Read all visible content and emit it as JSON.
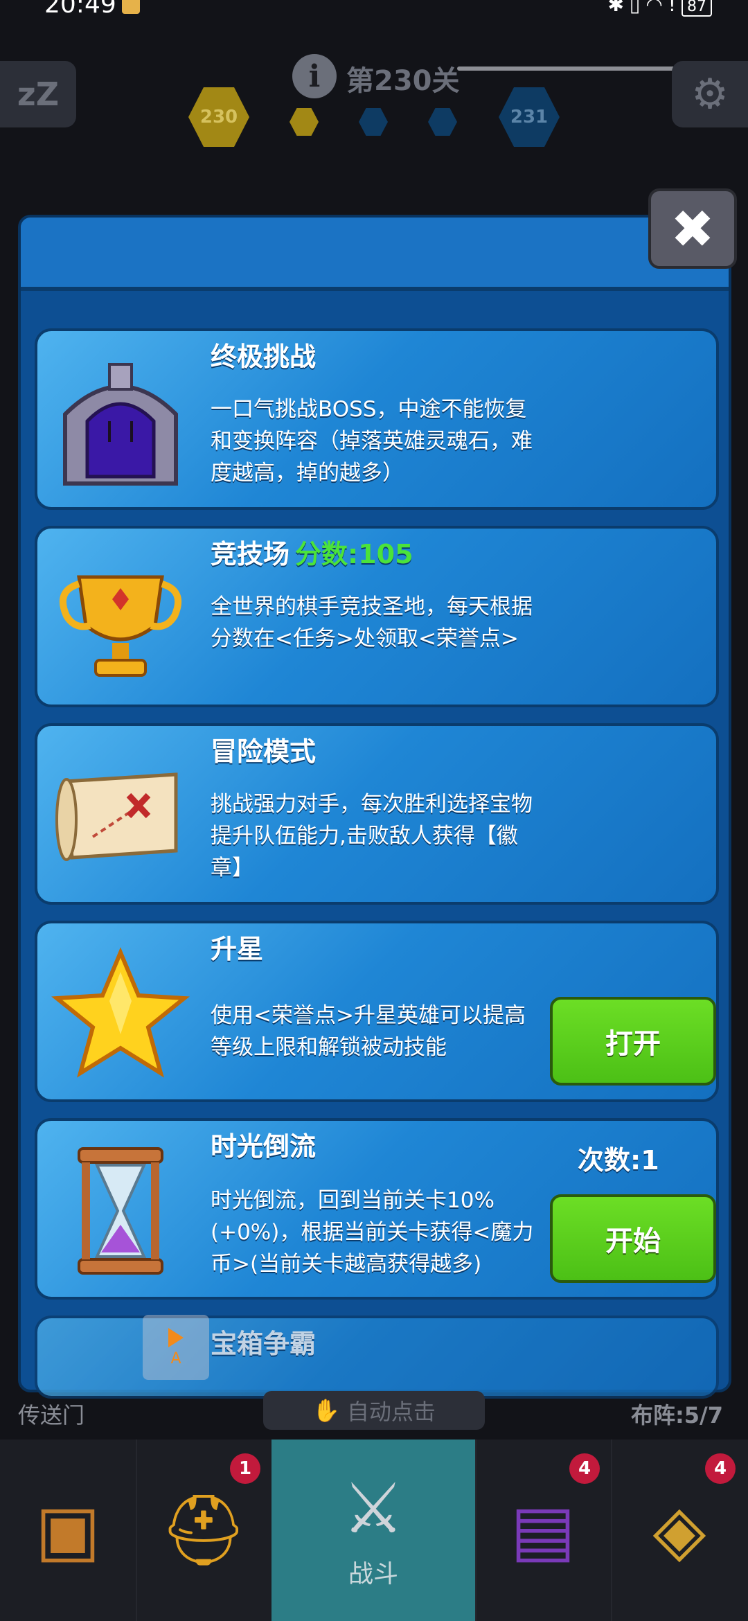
{
  "status_bar": {
    "time": "20:49",
    "battery": "87",
    "icons": [
      "bluetooth-icon",
      "vibrate-icon",
      "wifi-icon",
      "alert-icon",
      "battery-icon"
    ]
  },
  "top_bar": {
    "level_title": "第230关",
    "current_level": "230",
    "next_level": "231"
  },
  "dialog": {
    "cards": [
      {
        "title": "终极挑战",
        "description": "一口气挑战BOSS，中途不能恢复和变换阵容（掉落英雄灵魂石，难度越高，掉的越多）",
        "icon": "stone-gate-icon"
      },
      {
        "title": "竞技场",
        "score_label": "分数:105",
        "description": "全世界的棋手竞技圣地，每天根据分数在<任务>处领取<荣誉点>",
        "icon": "trophy-icon"
      },
      {
        "title": "冒险模式",
        "description": "挑战强力对手，每次胜利选择宝物提升队伍能力,击败敌人获得【徽章】",
        "icon": "treasure-map-icon"
      },
      {
        "title": "升星",
        "description": "使用<荣誉点>升星英雄可以提高等级上限和解锁被动技能",
        "button": "打开",
        "icon": "star-icon"
      },
      {
        "title": "时光倒流",
        "count_label": "次数:1",
        "description": "时光倒流，回到当前关卡10%(+0%)，根据当前关卡获得<魔力币>(当前关卡越高获得越多)",
        "button": "开始",
        "icon": "hourglass-icon"
      },
      {
        "title": "宝箱争霸"
      }
    ],
    "ad_badge_letter": "A"
  },
  "bottom_info": {
    "left_label": "传送门",
    "center_label": "自动点击",
    "right_label": "布阵:5/7"
  },
  "nav": {
    "items": [
      {
        "icon": "treasure-chest-icon",
        "badge": ""
      },
      {
        "icon": "winged-helmet-icon",
        "badge": "1"
      },
      {
        "icon": "crossed-swords-icon",
        "label": "战斗",
        "badge": ""
      },
      {
        "icon": "spellbook-icon",
        "badge": "4"
      },
      {
        "icon": "amulet-icon",
        "badge": "4"
      }
    ]
  },
  "colors": {
    "card_blue": "#1f86d5",
    "button_green": "#4cc016",
    "score_green": "#4be33a",
    "badge_red": "#c21a3c",
    "active_tab": "#2c7d86"
  }
}
